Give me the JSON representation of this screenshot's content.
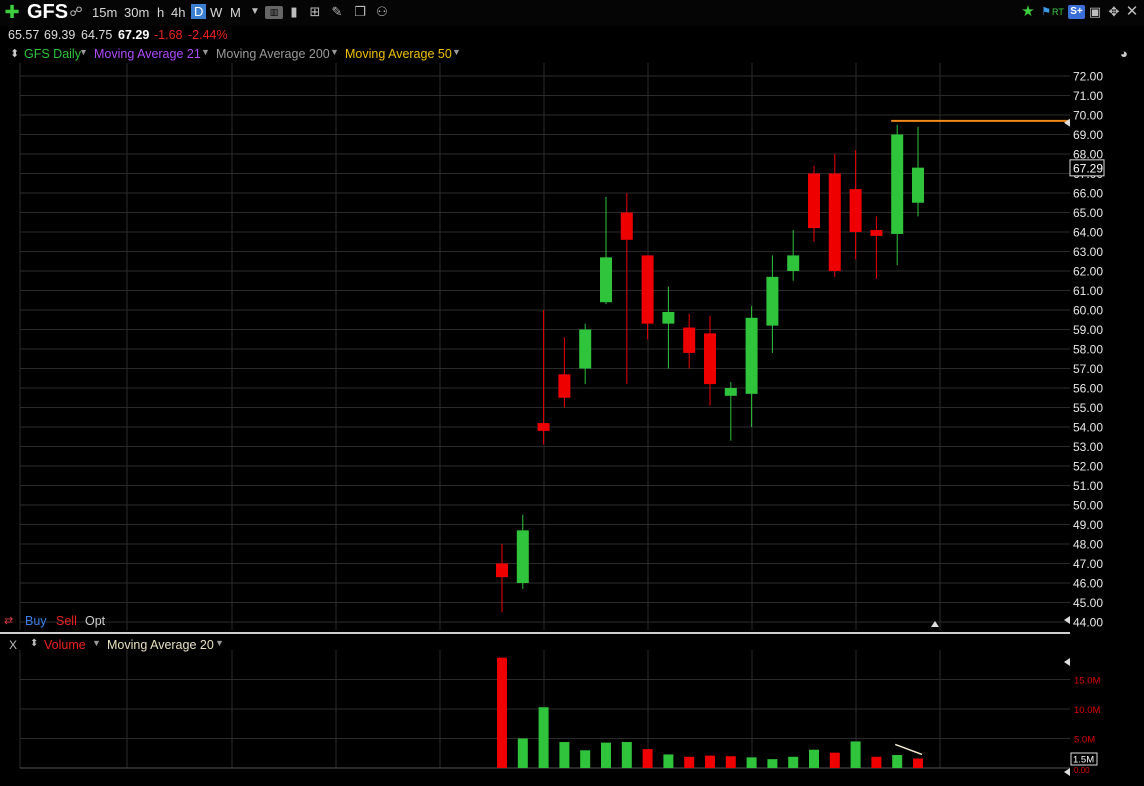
{
  "toolbar": {
    "symbol": "GFS",
    "timeframes": [
      "15m",
      "30m",
      "h",
      "4h",
      "D",
      "W",
      "M"
    ],
    "active_timeframe": "D",
    "rt_label": "RT"
  },
  "quote": {
    "open": "65.57",
    "high": "69.39",
    "low": "64.75",
    "last": "67.29",
    "change": "-1.68",
    "change_pct": "-2.44%"
  },
  "legend": {
    "series_label": "GFS Daily",
    "ma21_label": "Moving Average 21",
    "ma200_label": "Moving Average 200",
    "ma50_label": "Moving Average 50"
  },
  "trade": {
    "buy": "Buy",
    "sell": "Sell",
    "opt": "Opt"
  },
  "volume_pane": {
    "close_label": "X",
    "volume_label": "Volume",
    "ma_label": "Moving Average 20"
  },
  "colors": {
    "up": "#2fc43b",
    "down": "#ee0000",
    "ma21": "#b04bff",
    "ma200": "#9a9a9a",
    "ma50": "#f0c000",
    "orange_line": "#f08a1a",
    "grid": "#2b2b2b",
    "price_axis": "#e8e8e8",
    "vol_axis": "#e00000"
  },
  "chart_data": [
    {
      "type": "candlestick",
      "ylim": [
        44,
        72.5
      ],
      "y_ticks": [
        "72.00",
        "71.00",
        "70.00",
        "69.00",
        "68.00",
        "67.00",
        "66.00",
        "65.00",
        "64.00",
        "63.00",
        "62.00",
        "61.00",
        "60.00",
        "59.00",
        "58.00",
        "57.00",
        "56.00",
        "55.00",
        "54.00",
        "53.00",
        "52.00",
        "51.00",
        "50.00",
        "49.00",
        "48.00",
        "47.00",
        "46.00",
        "45.00",
        "44.00"
      ],
      "last_price_label": "67.29",
      "last_price": 67.29,
      "horizontal_line": {
        "value": 69.7,
        "start_index": 19
      },
      "candles": [
        {
          "o": 47.0,
          "h": 48.0,
          "l": 44.5,
          "c": 46.3
        },
        {
          "o": 46.0,
          "h": 49.5,
          "l": 45.7,
          "c": 48.7
        },
        {
          "o": 54.2,
          "h": 60.0,
          "l": 53.1,
          "c": 53.8
        },
        {
          "o": 56.7,
          "h": 58.6,
          "l": 55.0,
          "c": 55.5
        },
        {
          "o": 57.0,
          "h": 59.3,
          "l": 56.2,
          "c": 59.0
        },
        {
          "o": 60.4,
          "h": 65.8,
          "l": 60.3,
          "c": 62.7
        },
        {
          "o": 65.0,
          "h": 66.0,
          "l": 56.2,
          "c": 63.6
        },
        {
          "o": 62.8,
          "h": 62.8,
          "l": 58.5,
          "c": 59.3
        },
        {
          "o": 59.3,
          "h": 61.2,
          "l": 57.0,
          "c": 59.9
        },
        {
          "o": 59.1,
          "h": 59.8,
          "l": 57.0,
          "c": 57.8
        },
        {
          "o": 58.8,
          "h": 59.7,
          "l": 55.1,
          "c": 56.2
        },
        {
          "o": 55.6,
          "h": 56.3,
          "l": 53.3,
          "c": 56.0
        },
        {
          "o": 55.7,
          "h": 60.2,
          "l": 54.0,
          "c": 59.6
        },
        {
          "o": 59.2,
          "h": 62.8,
          "l": 57.8,
          "c": 61.7
        },
        {
          "o": 62.0,
          "h": 64.1,
          "l": 61.5,
          "c": 62.8
        },
        {
          "o": 67.0,
          "h": 67.4,
          "l": 63.5,
          "c": 64.2
        },
        {
          "o": 67.0,
          "h": 68.0,
          "l": 61.7,
          "c": 62.0
        },
        {
          "o": 66.2,
          "h": 68.2,
          "l": 62.6,
          "c": 64.0
        },
        {
          "o": 64.1,
          "h": 64.8,
          "l": 61.6,
          "c": 63.8
        },
        {
          "o": 63.9,
          "h": 69.5,
          "l": 62.3,
          "c": 69.0
        },
        {
          "o": 65.5,
          "h": 69.4,
          "l": 64.8,
          "c": 67.3
        }
      ]
    },
    {
      "type": "bar",
      "ylim": [
        0,
        19
      ],
      "y_ticks": [
        "15.0M",
        "10.0M",
        "5.0M"
      ],
      "y_tick_values": [
        15,
        10,
        5
      ],
      "last_volume_label": "1.5M",
      "zero_label": "0.00",
      "values_millions": [
        18.7,
        5.0,
        10.3,
        4.4,
        3.0,
        4.3,
        4.4,
        3.2,
        2.3,
        1.9,
        2.1,
        2.0,
        1.8,
        1.5,
        1.9,
        3.1,
        2.6,
        4.5,
        1.9,
        2.2,
        1.6
      ],
      "directions": [
        "down",
        "up",
        "up",
        "up",
        "up",
        "up",
        "up",
        "down",
        "up",
        "down",
        "down",
        "down",
        "up",
        "up",
        "up",
        "up",
        "down",
        "up",
        "down",
        "up",
        "down"
      ],
      "ma_segment": [
        4.0,
        2.3
      ]
    }
  ]
}
